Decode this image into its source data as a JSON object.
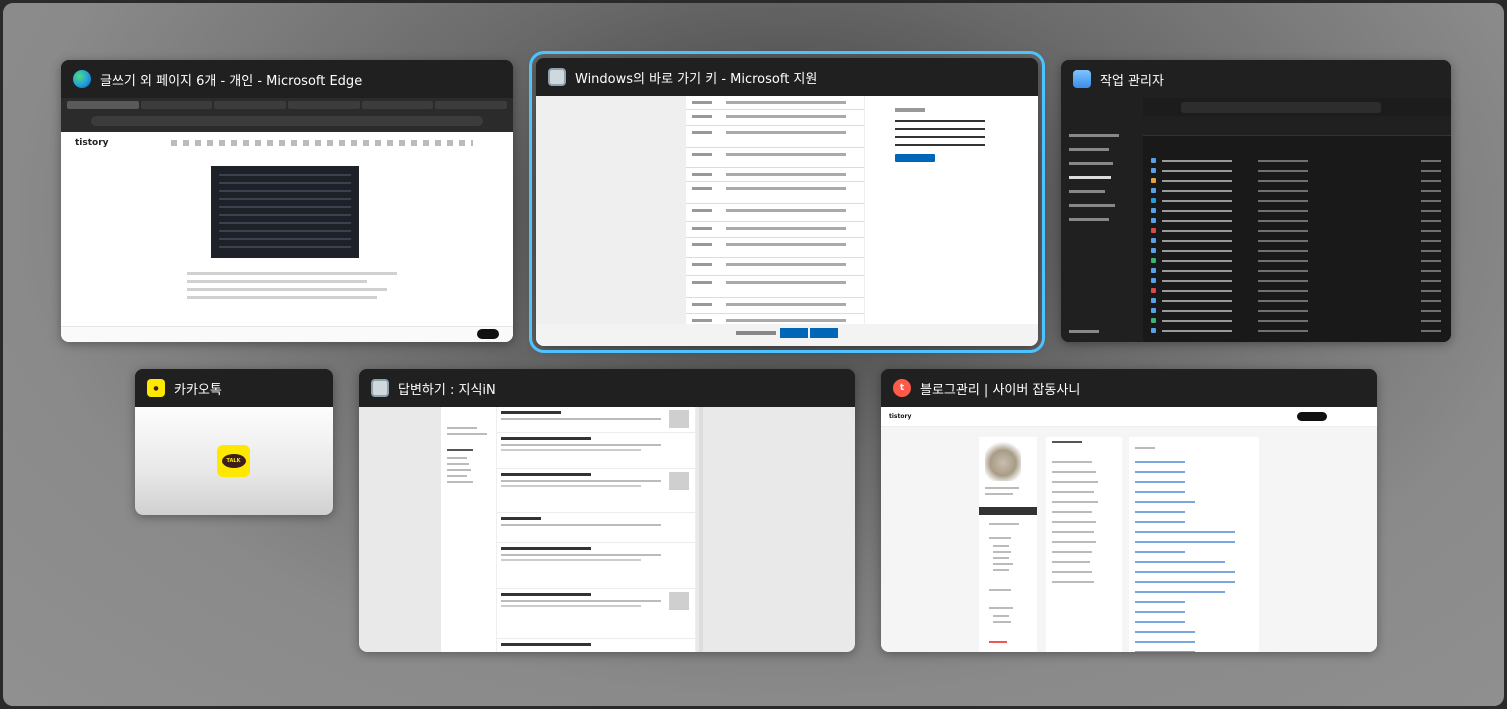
{
  "windows": {
    "edge": {
      "title": "글쓰기 외 페이지 6개 - 개인 - Microsoft Edge",
      "icon": "edge-icon",
      "thumb_logo": "tistory"
    },
    "ms_support": {
      "title": "Windows의 바로 가기 키 - Microsoft 지원",
      "icon": "window-icon",
      "selected": true
    },
    "task_manager": {
      "title": "작업 관리자",
      "icon": "task-manager-icon"
    },
    "kakaotalk": {
      "title": "카카오톡",
      "icon": "kakaotalk-icon",
      "logo_text": "TALK"
    },
    "kin": {
      "title": "답변하기 : 지식iN",
      "icon": "window-icon"
    },
    "blog": {
      "title": "블로그관리 | 사이버 잡동사니",
      "icon": "tistory-icon",
      "thumb_logo": "tistory"
    }
  },
  "colors": {
    "selection_outline": "#4cc2ff",
    "titlebar_bg": "#202020",
    "kakao_yellow": "#ffe800",
    "ms_blue": "#0067b8"
  }
}
